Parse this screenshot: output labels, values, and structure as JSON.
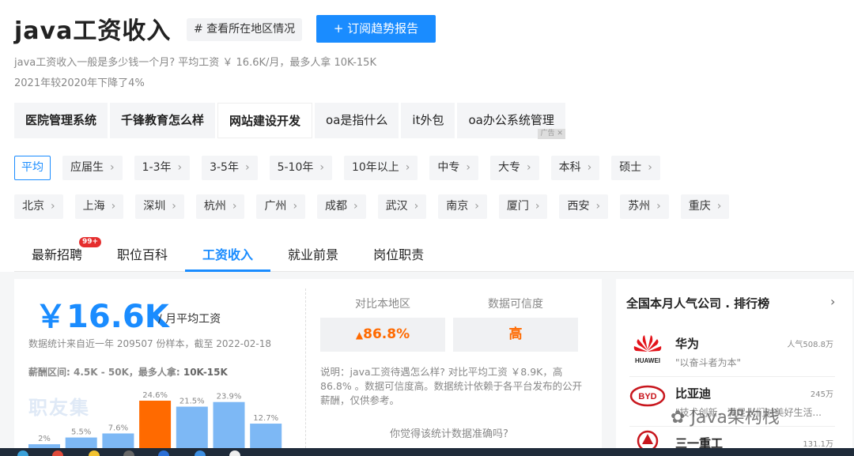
{
  "header": {
    "title": "java工资收入",
    "region_button": "# 查看所在地区情况",
    "subscribe_button": "+ 订阅趋势报告",
    "desc1": "java工资收入一般是多少钱一个月? 平均工资 ￥ 16.6K/月，最多人拿 10K-15K",
    "desc2": "2021年较2020年下降了4%"
  },
  "keywords": [
    "医院管理系统",
    "千锋教育怎么样",
    "网站建设开发",
    "oa是指什么",
    "it外包",
    "oa办公系统管理"
  ],
  "ad_label": "广告",
  "experience_filters": [
    "平均",
    "应届生",
    "1-3年",
    "3-5年",
    "5-10年",
    "10年以上",
    "中专",
    "大专",
    "本科",
    "硕士"
  ],
  "city_filters": [
    "北京",
    "上海",
    "深圳",
    "杭州",
    "广州",
    "成都",
    "武汉",
    "南京",
    "厦门",
    "西安",
    "苏州",
    "重庆"
  ],
  "tabs": [
    "最新招聘",
    "职位百科",
    "工资收入",
    "就业前景",
    "岗位职责"
  ],
  "tab_badge": "99+",
  "salary": {
    "amount": "￥16.6K",
    "unit": "/ 月平均工资",
    "stats": "数据统计来自近一年 209507 份样本，截至 2022-02-18",
    "range_prefix": "薪酬区间: 4.5K - 50K，最多人拿:",
    "range_most": "10K-15K",
    "watermark": "职友集"
  },
  "chart_data": {
    "type": "bar",
    "values": [
      2,
      5.5,
      7.6,
      24.6,
      21.5,
      23.9,
      12.7
    ],
    "labels": [
      "2%",
      "5.5%",
      "7.6%",
      "24.6%",
      "21.5%",
      "23.9%",
      "12.7%"
    ],
    "highlight_index": 3,
    "colors": {
      "normal": "#7db8f5",
      "highlight": "#ff6a00"
    }
  },
  "compare": {
    "local_label": "对比本地区",
    "local_value": "86.8%",
    "trust_label": "数据可信度",
    "trust_value": "高",
    "note": "说明：java工资待遇怎么样? 对比平均工资 ￥8.9K，高 86.8% 。数据可信度高。数据统计依赖于各平台发布的公开薪酬，仅供参考。",
    "ask": "你觉得该统计数据准确吗?"
  },
  "ranking": {
    "title": "全国本月人气公司 . 排行榜",
    "companies": [
      {
        "name": "华为",
        "slogan": "\"以奋斗者为本\"",
        "heat": "人气508.8万",
        "logo_text": "HUAWEI"
      },
      {
        "name": "比亚迪",
        "slogan": "\"技术创新，满足人们对美好生活...",
        "heat": "245万",
        "logo_text": "BYD"
      },
      {
        "name": "三一重工",
        "slogan": "",
        "heat": "131.1万",
        "logo_text": ""
      }
    ]
  },
  "overlay_watermark": "Java架构栈",
  "colors": {
    "accent": "#1a8cff",
    "orange": "#ff6a00",
    "badge": "#e52e2e"
  }
}
